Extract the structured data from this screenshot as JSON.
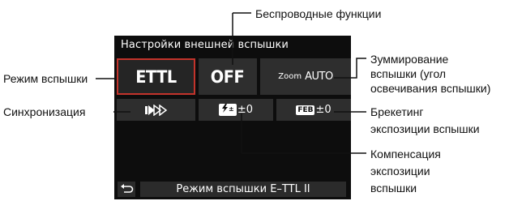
{
  "screen": {
    "title": "Настройки внешней вспышки",
    "flash_mode_value": "ETTL",
    "wireless_value": "OFF",
    "zoom_word": "Zoom",
    "zoom_value": "AUTO",
    "comp_icon": "±",
    "comp_value": "±0",
    "feb_icon": "FEB",
    "feb_value": "±0",
    "status_text": "Режим вспышки E–TTL II"
  },
  "callouts": {
    "wireless": "Беспроводные функции",
    "flash_mode": "Режим вспышки",
    "sync": "Синхронизация",
    "zoom_line1": "Зуммирование",
    "zoom_line2": "вспышки (угол",
    "zoom_line3": "освечивания вспышки)",
    "feb_line1": "Брекетинг",
    "feb_line2": "экспозиции вспышки",
    "comp_line1": "Компенсация",
    "comp_line2": "экспозиции",
    "comp_line3": "вспышки"
  },
  "icons": {
    "sync": "high-speed-sync-icon",
    "back": "return-arrow-icon",
    "comp": "flash-exposure-compensation-icon",
    "feb": "feb-icon"
  }
}
